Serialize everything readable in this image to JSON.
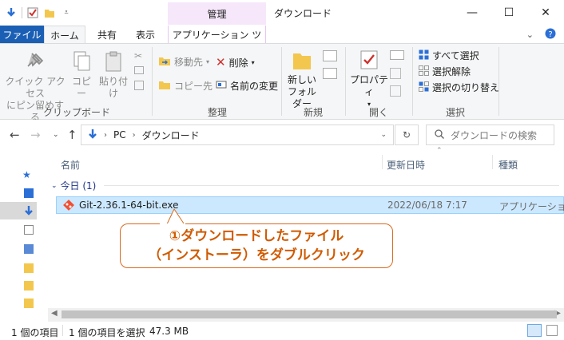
{
  "window": {
    "title": "ダウンロード",
    "context_tab_group": "管理",
    "controls": {
      "minimize": "—",
      "maximize": "☐",
      "close": "✕"
    }
  },
  "ribbon_tabs": {
    "file": "ファイル",
    "home": "ホーム",
    "share": "共有",
    "view": "表示",
    "app_tools": "アプリケーション ツール"
  },
  "ribbon": {
    "clipboard": {
      "quick_access_line1": "クイック アクセス",
      "quick_access_line2": "にピン留めする",
      "copy": "コピー",
      "paste": "貼り付け",
      "label": "クリップボード"
    },
    "organize": {
      "move_to": "移動先",
      "copy_to": "コピー先",
      "delete": "削除",
      "rename": "名前の変更",
      "label": "整理"
    },
    "new": {
      "new_folder_line1": "新しい",
      "new_folder_line2": "フォルダー",
      "label": "新規"
    },
    "open": {
      "properties": "プロパティ",
      "label": "開く"
    },
    "select": {
      "select_all": "すべて選択",
      "select_none": "選択解除",
      "invert": "選択の切り替え",
      "label": "選択"
    }
  },
  "address": {
    "crumbs": [
      "PC",
      "ダウンロード"
    ],
    "search_placeholder": "ダウンロードの検索"
  },
  "columns": {
    "name": "名前",
    "date": "更新日時",
    "type": "種類"
  },
  "group": {
    "label": "今日 (1)"
  },
  "files": [
    {
      "name": "Git-2.36.1-64-bit.exe",
      "date": "2022/06/18 7:17",
      "type": "アプリケーション"
    }
  ],
  "callout": {
    "line1": "①ダウンロードしたファイル",
    "line2": "（インストーラ）をダブルクリック"
  },
  "status": {
    "count": "1 個の項目",
    "selected": "1 個の項目を選択",
    "size": "47.3 MB"
  },
  "colors": {
    "accent": "#1a5fb4",
    "selection": "#cce8ff",
    "callout": "#d86a1f",
    "context_tab": "#f6e7fb"
  }
}
